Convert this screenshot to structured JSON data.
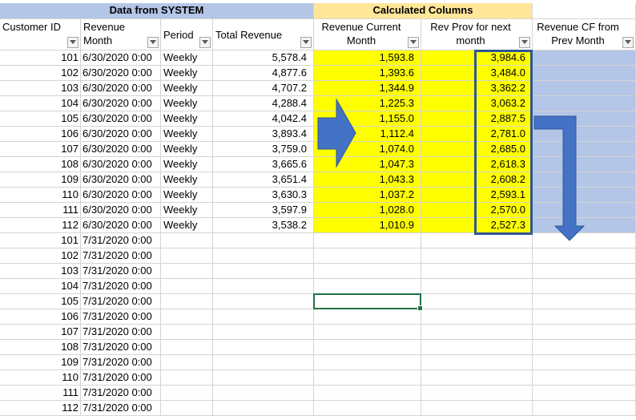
{
  "group_headers": {
    "system": "Data from SYSTEM",
    "calculated": "Calculated Columns"
  },
  "columns": [
    {
      "l1": "",
      "l2": "Customer ID"
    },
    {
      "l1": "Revenue",
      "l2": "Month"
    },
    {
      "l1": "Period",
      "l2": ""
    },
    {
      "l1": "Total Revenue",
      "l2": ""
    },
    {
      "l1": "Revenue Current",
      "l2": "Month"
    },
    {
      "l1": "Rev Prov for next",
      "l2": "month"
    },
    {
      "l1": "Revenue CF from",
      "l2": "Prev Month"
    }
  ],
  "rows": [
    [
      "101",
      "6/30/2020 0:00",
      "Weekly",
      "5,578.4",
      "1,593.8",
      "3,984.6",
      ""
    ],
    [
      "102",
      "6/30/2020 0:00",
      "Weekly",
      "4,877.6",
      "1,393.6",
      "3,484.0",
      ""
    ],
    [
      "103",
      "6/30/2020 0:00",
      "Weekly",
      "4,707.2",
      "1,344.9",
      "3,362.2",
      ""
    ],
    [
      "104",
      "6/30/2020 0:00",
      "Weekly",
      "4,288.4",
      "1,225.3",
      "3,063.2",
      ""
    ],
    [
      "105",
      "6/30/2020 0:00",
      "Weekly",
      "4,042.4",
      "1,155.0",
      "2,887.5",
      ""
    ],
    [
      "106",
      "6/30/2020 0:00",
      "Weekly",
      "3,893.4",
      "1,112.4",
      "2,781.0",
      ""
    ],
    [
      "107",
      "6/30/2020 0:00",
      "Weekly",
      "3,759.0",
      "1,074.0",
      "2,685.0",
      ""
    ],
    [
      "108",
      "6/30/2020 0:00",
      "Weekly",
      "3,665.6",
      "1,047.3",
      "2,618.3",
      ""
    ],
    [
      "109",
      "6/30/2020 0:00",
      "Weekly",
      "3,651.4",
      "1,043.3",
      "2,608.2",
      ""
    ],
    [
      "110",
      "6/30/2020 0:00",
      "Weekly",
      "3,630.3",
      "1,037.2",
      "2,593.1",
      ""
    ],
    [
      "111",
      "6/30/2020 0:00",
      "Weekly",
      "3,597.9",
      "1,028.0",
      "2,570.0",
      ""
    ],
    [
      "112",
      "6/30/2020 0:00",
      "Weekly",
      "3,538.2",
      "1,010.9",
      "2,527.3",
      ""
    ],
    [
      "101",
      "7/31/2020 0:00",
      "",
      "",
      "",
      "",
      ""
    ],
    [
      "102",
      "7/31/2020 0:00",
      "",
      "",
      "",
      "",
      ""
    ],
    [
      "103",
      "7/31/2020 0:00",
      "",
      "",
      "",
      "",
      ""
    ],
    [
      "104",
      "7/31/2020 0:00",
      "",
      "",
      "",
      "",
      ""
    ],
    [
      "105",
      "7/31/2020 0:00",
      "",
      "",
      "",
      "",
      ""
    ],
    [
      "106",
      "7/31/2020 0:00",
      "",
      "",
      "",
      "",
      ""
    ],
    [
      "107",
      "7/31/2020 0:00",
      "",
      "",
      "",
      "",
      ""
    ],
    [
      "108",
      "7/31/2020 0:00",
      "",
      "",
      "",
      "",
      ""
    ],
    [
      "109",
      "7/31/2020 0:00",
      "",
      "",
      "",
      "",
      ""
    ],
    [
      "110",
      "7/31/2020 0:00",
      "",
      "",
      "",
      "",
      ""
    ],
    [
      "111",
      "7/31/2020 0:00",
      "",
      "",
      "",
      "",
      ""
    ],
    [
      "112",
      "7/31/2020 0:00",
      "",
      "",
      "",
      "",
      ""
    ]
  ],
  "colors": {
    "yellow_fill": "#ffff00",
    "blue_fill": "#b4c6e7",
    "calc_header_fill": "#ffe699",
    "arrow_fill": "#4472c4",
    "selection_border": "#217346"
  },
  "icons": {
    "filter": "filter-dropdown-icon",
    "arrow_right": "right-arrow-icon",
    "arrow_bent": "bent-down-arrow-icon"
  }
}
